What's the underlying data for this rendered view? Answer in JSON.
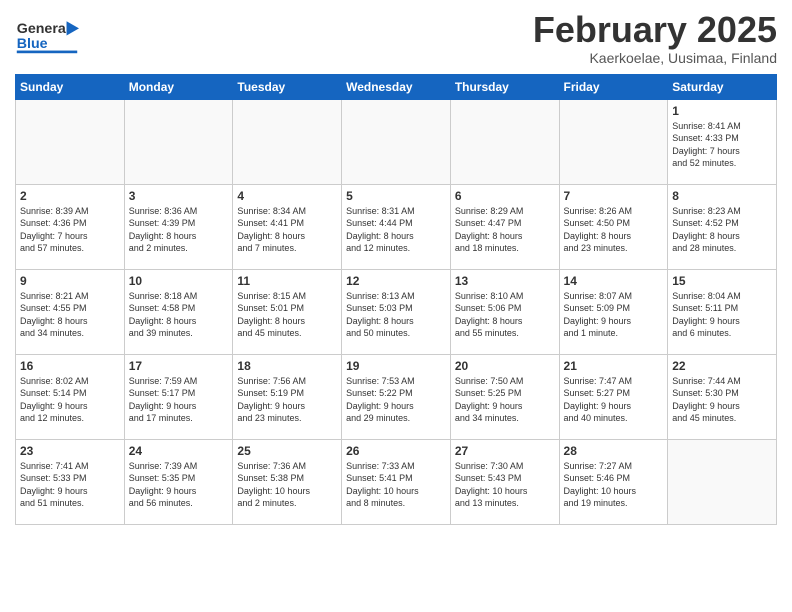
{
  "header": {
    "logo_general": "General",
    "logo_blue": "Blue",
    "month": "February 2025",
    "location": "Kaerkoelae, Uusimaa, Finland"
  },
  "weekdays": [
    "Sunday",
    "Monday",
    "Tuesday",
    "Wednesday",
    "Thursday",
    "Friday",
    "Saturday"
  ],
  "weeks": [
    [
      {
        "day": "",
        "info": ""
      },
      {
        "day": "",
        "info": ""
      },
      {
        "day": "",
        "info": ""
      },
      {
        "day": "",
        "info": ""
      },
      {
        "day": "",
        "info": ""
      },
      {
        "day": "",
        "info": ""
      },
      {
        "day": "1",
        "info": "Sunrise: 8:41 AM\nSunset: 4:33 PM\nDaylight: 7 hours\nand 52 minutes."
      }
    ],
    [
      {
        "day": "2",
        "info": "Sunrise: 8:39 AM\nSunset: 4:36 PM\nDaylight: 7 hours\nand 57 minutes."
      },
      {
        "day": "3",
        "info": "Sunrise: 8:36 AM\nSunset: 4:39 PM\nDaylight: 8 hours\nand 2 minutes."
      },
      {
        "day": "4",
        "info": "Sunrise: 8:34 AM\nSunset: 4:41 PM\nDaylight: 8 hours\nand 7 minutes."
      },
      {
        "day": "5",
        "info": "Sunrise: 8:31 AM\nSunset: 4:44 PM\nDaylight: 8 hours\nand 12 minutes."
      },
      {
        "day": "6",
        "info": "Sunrise: 8:29 AM\nSunset: 4:47 PM\nDaylight: 8 hours\nand 18 minutes."
      },
      {
        "day": "7",
        "info": "Sunrise: 8:26 AM\nSunset: 4:50 PM\nDaylight: 8 hours\nand 23 minutes."
      },
      {
        "day": "8",
        "info": "Sunrise: 8:23 AM\nSunset: 4:52 PM\nDaylight: 8 hours\nand 28 minutes."
      }
    ],
    [
      {
        "day": "9",
        "info": "Sunrise: 8:21 AM\nSunset: 4:55 PM\nDaylight: 8 hours\nand 34 minutes."
      },
      {
        "day": "10",
        "info": "Sunrise: 8:18 AM\nSunset: 4:58 PM\nDaylight: 8 hours\nand 39 minutes."
      },
      {
        "day": "11",
        "info": "Sunrise: 8:15 AM\nSunset: 5:01 PM\nDaylight: 8 hours\nand 45 minutes."
      },
      {
        "day": "12",
        "info": "Sunrise: 8:13 AM\nSunset: 5:03 PM\nDaylight: 8 hours\nand 50 minutes."
      },
      {
        "day": "13",
        "info": "Sunrise: 8:10 AM\nSunset: 5:06 PM\nDaylight: 8 hours\nand 55 minutes."
      },
      {
        "day": "14",
        "info": "Sunrise: 8:07 AM\nSunset: 5:09 PM\nDaylight: 9 hours\nand 1 minute."
      },
      {
        "day": "15",
        "info": "Sunrise: 8:04 AM\nSunset: 5:11 PM\nDaylight: 9 hours\nand 6 minutes."
      }
    ],
    [
      {
        "day": "16",
        "info": "Sunrise: 8:02 AM\nSunset: 5:14 PM\nDaylight: 9 hours\nand 12 minutes."
      },
      {
        "day": "17",
        "info": "Sunrise: 7:59 AM\nSunset: 5:17 PM\nDaylight: 9 hours\nand 17 minutes."
      },
      {
        "day": "18",
        "info": "Sunrise: 7:56 AM\nSunset: 5:19 PM\nDaylight: 9 hours\nand 23 minutes."
      },
      {
        "day": "19",
        "info": "Sunrise: 7:53 AM\nSunset: 5:22 PM\nDaylight: 9 hours\nand 29 minutes."
      },
      {
        "day": "20",
        "info": "Sunrise: 7:50 AM\nSunset: 5:25 PM\nDaylight: 9 hours\nand 34 minutes."
      },
      {
        "day": "21",
        "info": "Sunrise: 7:47 AM\nSunset: 5:27 PM\nDaylight: 9 hours\nand 40 minutes."
      },
      {
        "day": "22",
        "info": "Sunrise: 7:44 AM\nSunset: 5:30 PM\nDaylight: 9 hours\nand 45 minutes."
      }
    ],
    [
      {
        "day": "23",
        "info": "Sunrise: 7:41 AM\nSunset: 5:33 PM\nDaylight: 9 hours\nand 51 minutes."
      },
      {
        "day": "24",
        "info": "Sunrise: 7:39 AM\nSunset: 5:35 PM\nDaylight: 9 hours\nand 56 minutes."
      },
      {
        "day": "25",
        "info": "Sunrise: 7:36 AM\nSunset: 5:38 PM\nDaylight: 10 hours\nand 2 minutes."
      },
      {
        "day": "26",
        "info": "Sunrise: 7:33 AM\nSunset: 5:41 PM\nDaylight: 10 hours\nand 8 minutes."
      },
      {
        "day": "27",
        "info": "Sunrise: 7:30 AM\nSunset: 5:43 PM\nDaylight: 10 hours\nand 13 minutes."
      },
      {
        "day": "28",
        "info": "Sunrise: 7:27 AM\nSunset: 5:46 PM\nDaylight: 10 hours\nand 19 minutes."
      },
      {
        "day": "",
        "info": ""
      }
    ]
  ]
}
